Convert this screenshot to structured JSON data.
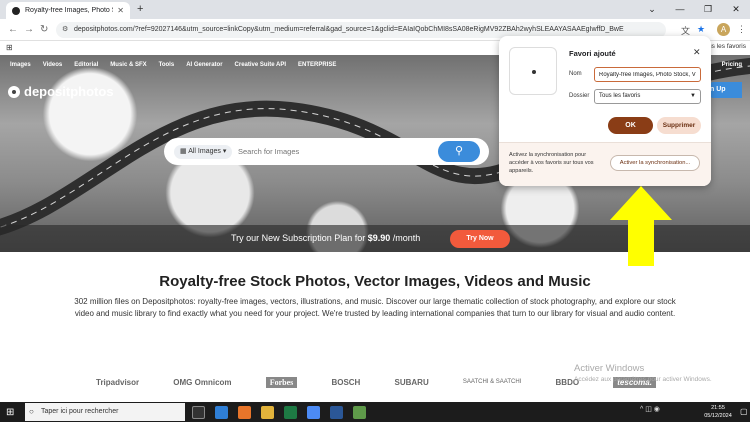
{
  "browser": {
    "tab_title": "Royalty-free Images, Photo Stock, V",
    "new_tab_symbol": "+",
    "url": "depositphotos.com/?ref=92027146&utm_source=linkCopy&utm_medium=referral&gad_source=1&gclid=EAIaIQobChMI8sSA08eRigMV92ZBAh2wyhSLEAAYASAAEgIwffD_BwE",
    "all_bookmarks": "Tous les favoris",
    "avatar_letter": "A"
  },
  "site": {
    "nav": [
      "Images",
      "Videos",
      "Editorial",
      "Music & SFX",
      "Tools",
      "AI Generator",
      "Creative Suite API",
      "ENTERPRISE"
    ],
    "pricing": "Pricing",
    "logo": "depositphotos",
    "signup": "n Up",
    "search": {
      "category": "All Images",
      "placeholder": "Search for Images"
    },
    "promo": {
      "prefix": "Try our New Subscription Plan for ",
      "price": "$9.90",
      "suffix": " /month",
      "button": "Try Now"
    },
    "headline": "Royalty-free Stock Photos, Vector Images, Videos and Music",
    "description": "302 million files on Depositphotos: royalty-free images, vectors, illustrations, and music. Discover our large thematic collection of stock photography, and explore our stock video and music library to find exactly what you need for your project. We're trusted by leading international companies that turn to our library for visual and audio content.",
    "brand_logos": [
      "Tripadvisor",
      "OMG Omnicom",
      "Forbes",
      "BOSCH",
      "SUBARU",
      "SAATCHI & SAATCHI",
      "BBDO",
      "tescoma."
    ]
  },
  "bookmark_popup": {
    "title": "Favori ajouté",
    "name_label": "Nom",
    "name_value": "Royalty-free Images, Photo Stock, Vide",
    "folder_label": "Dossier",
    "folder_value": "Tous les favoris",
    "ok": "OK",
    "delete": "Supprimer",
    "sync_text": "Activez la synchronisation pour accéder à vos favoris sur tous vos appareils.",
    "sync_button": "Activer la synchronisation..."
  },
  "windows": {
    "activate_title": "Activer Windows",
    "activate_sub": "Accédez aux paramètres pour activer Windows.",
    "search_placeholder": "Taper ici pour rechercher",
    "time": "21:55",
    "date": "05/12/2024"
  },
  "colors": {
    "accent_blue": "#3b8cdb",
    "promo_orange": "#f25a3c",
    "ok_brown": "#8a3d16",
    "arrow_yellow": "#ffff00"
  }
}
